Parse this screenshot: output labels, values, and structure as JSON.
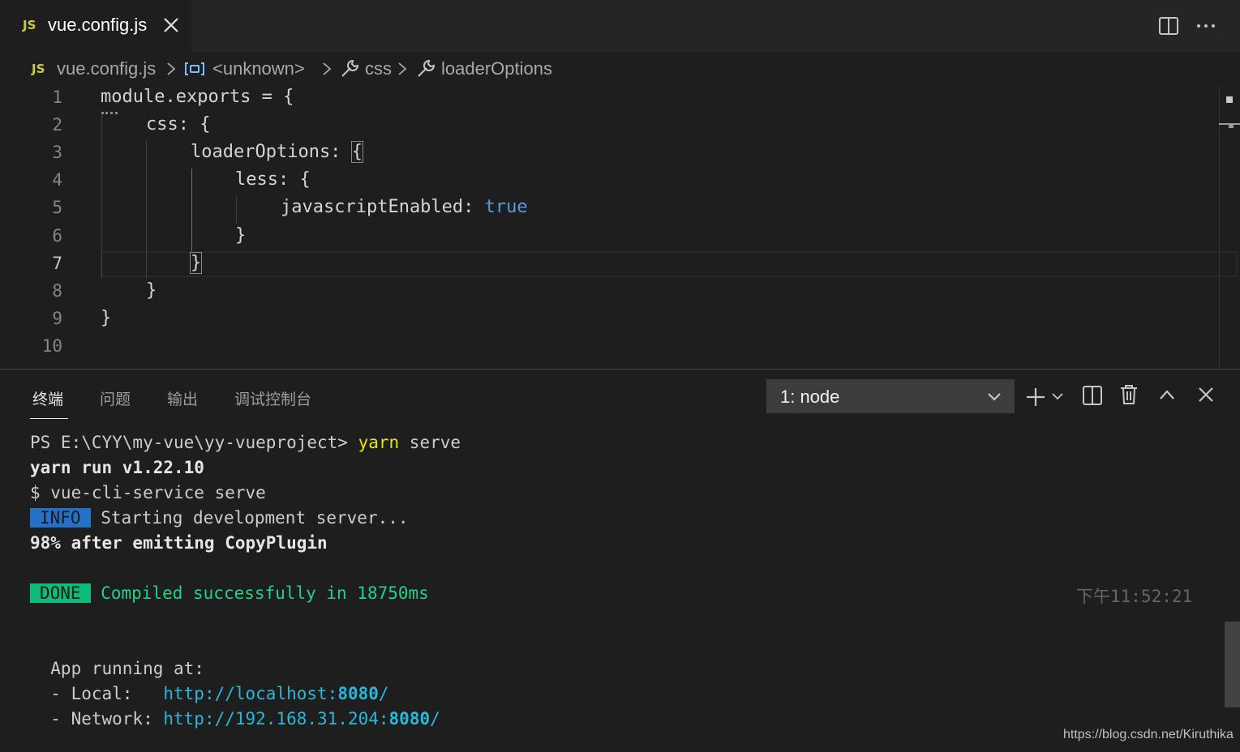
{
  "tab": {
    "badge": "JS",
    "title": "vue.config.js"
  },
  "breadcrumb": {
    "badge": "JS",
    "file": "vue.config.js",
    "symbol": "<unknown>",
    "prop1": "css",
    "prop2": "loaderOptions"
  },
  "editor": {
    "line_numbers": [
      "1",
      "2",
      "3",
      "4",
      "5",
      "6",
      "7",
      "8",
      "9",
      "10"
    ],
    "active_line": "7",
    "lines": {
      "l1": "module.exports = {",
      "l2": "css: {",
      "l3": "loaderOptions: ",
      "l3_brace": "{",
      "l4": "less: {",
      "l5_key": "javascriptEnabled: ",
      "l5_val": "true",
      "l6": "}",
      "l7": "}",
      "l8": "}",
      "l9": "}"
    }
  },
  "panel": {
    "tabs": [
      "终端",
      "问题",
      "输出",
      "调试控制台"
    ],
    "active_tab": "终端",
    "terminal_select": "1: node"
  },
  "terminal": {
    "prompt": "PS E:\\CYY\\my-vue\\yy-vueproject> ",
    "cmd": "yarn",
    "cmd_arg": " serve",
    "line2": "yarn run v1.22.10",
    "line3": "$ vue-cli-service serve",
    "info_badge": "INFO",
    "info_text": " Starting development server...",
    "progress": "98% after emitting CopyPlugin",
    "done_badge": "DONE",
    "done_text": " Compiled successfully in 18750ms",
    "time": "下午11:52:21",
    "app_running": "  App running at:",
    "local_label": "  - Local:   ",
    "local_url_pre": "http://localhost:",
    "local_port": "8080",
    "local_url_post": "/",
    "network_label": "  - Network: ",
    "network_url_pre": "http://192.168.31.204:",
    "network_port": "8080",
    "network_url_post": "/"
  },
  "watermark": "https://blog.csdn.net/Kiruthika",
  "colors": {
    "accent_info": "#2472c8",
    "accent_done": "#0dbc79",
    "js_badge": "#cbcb41"
  }
}
